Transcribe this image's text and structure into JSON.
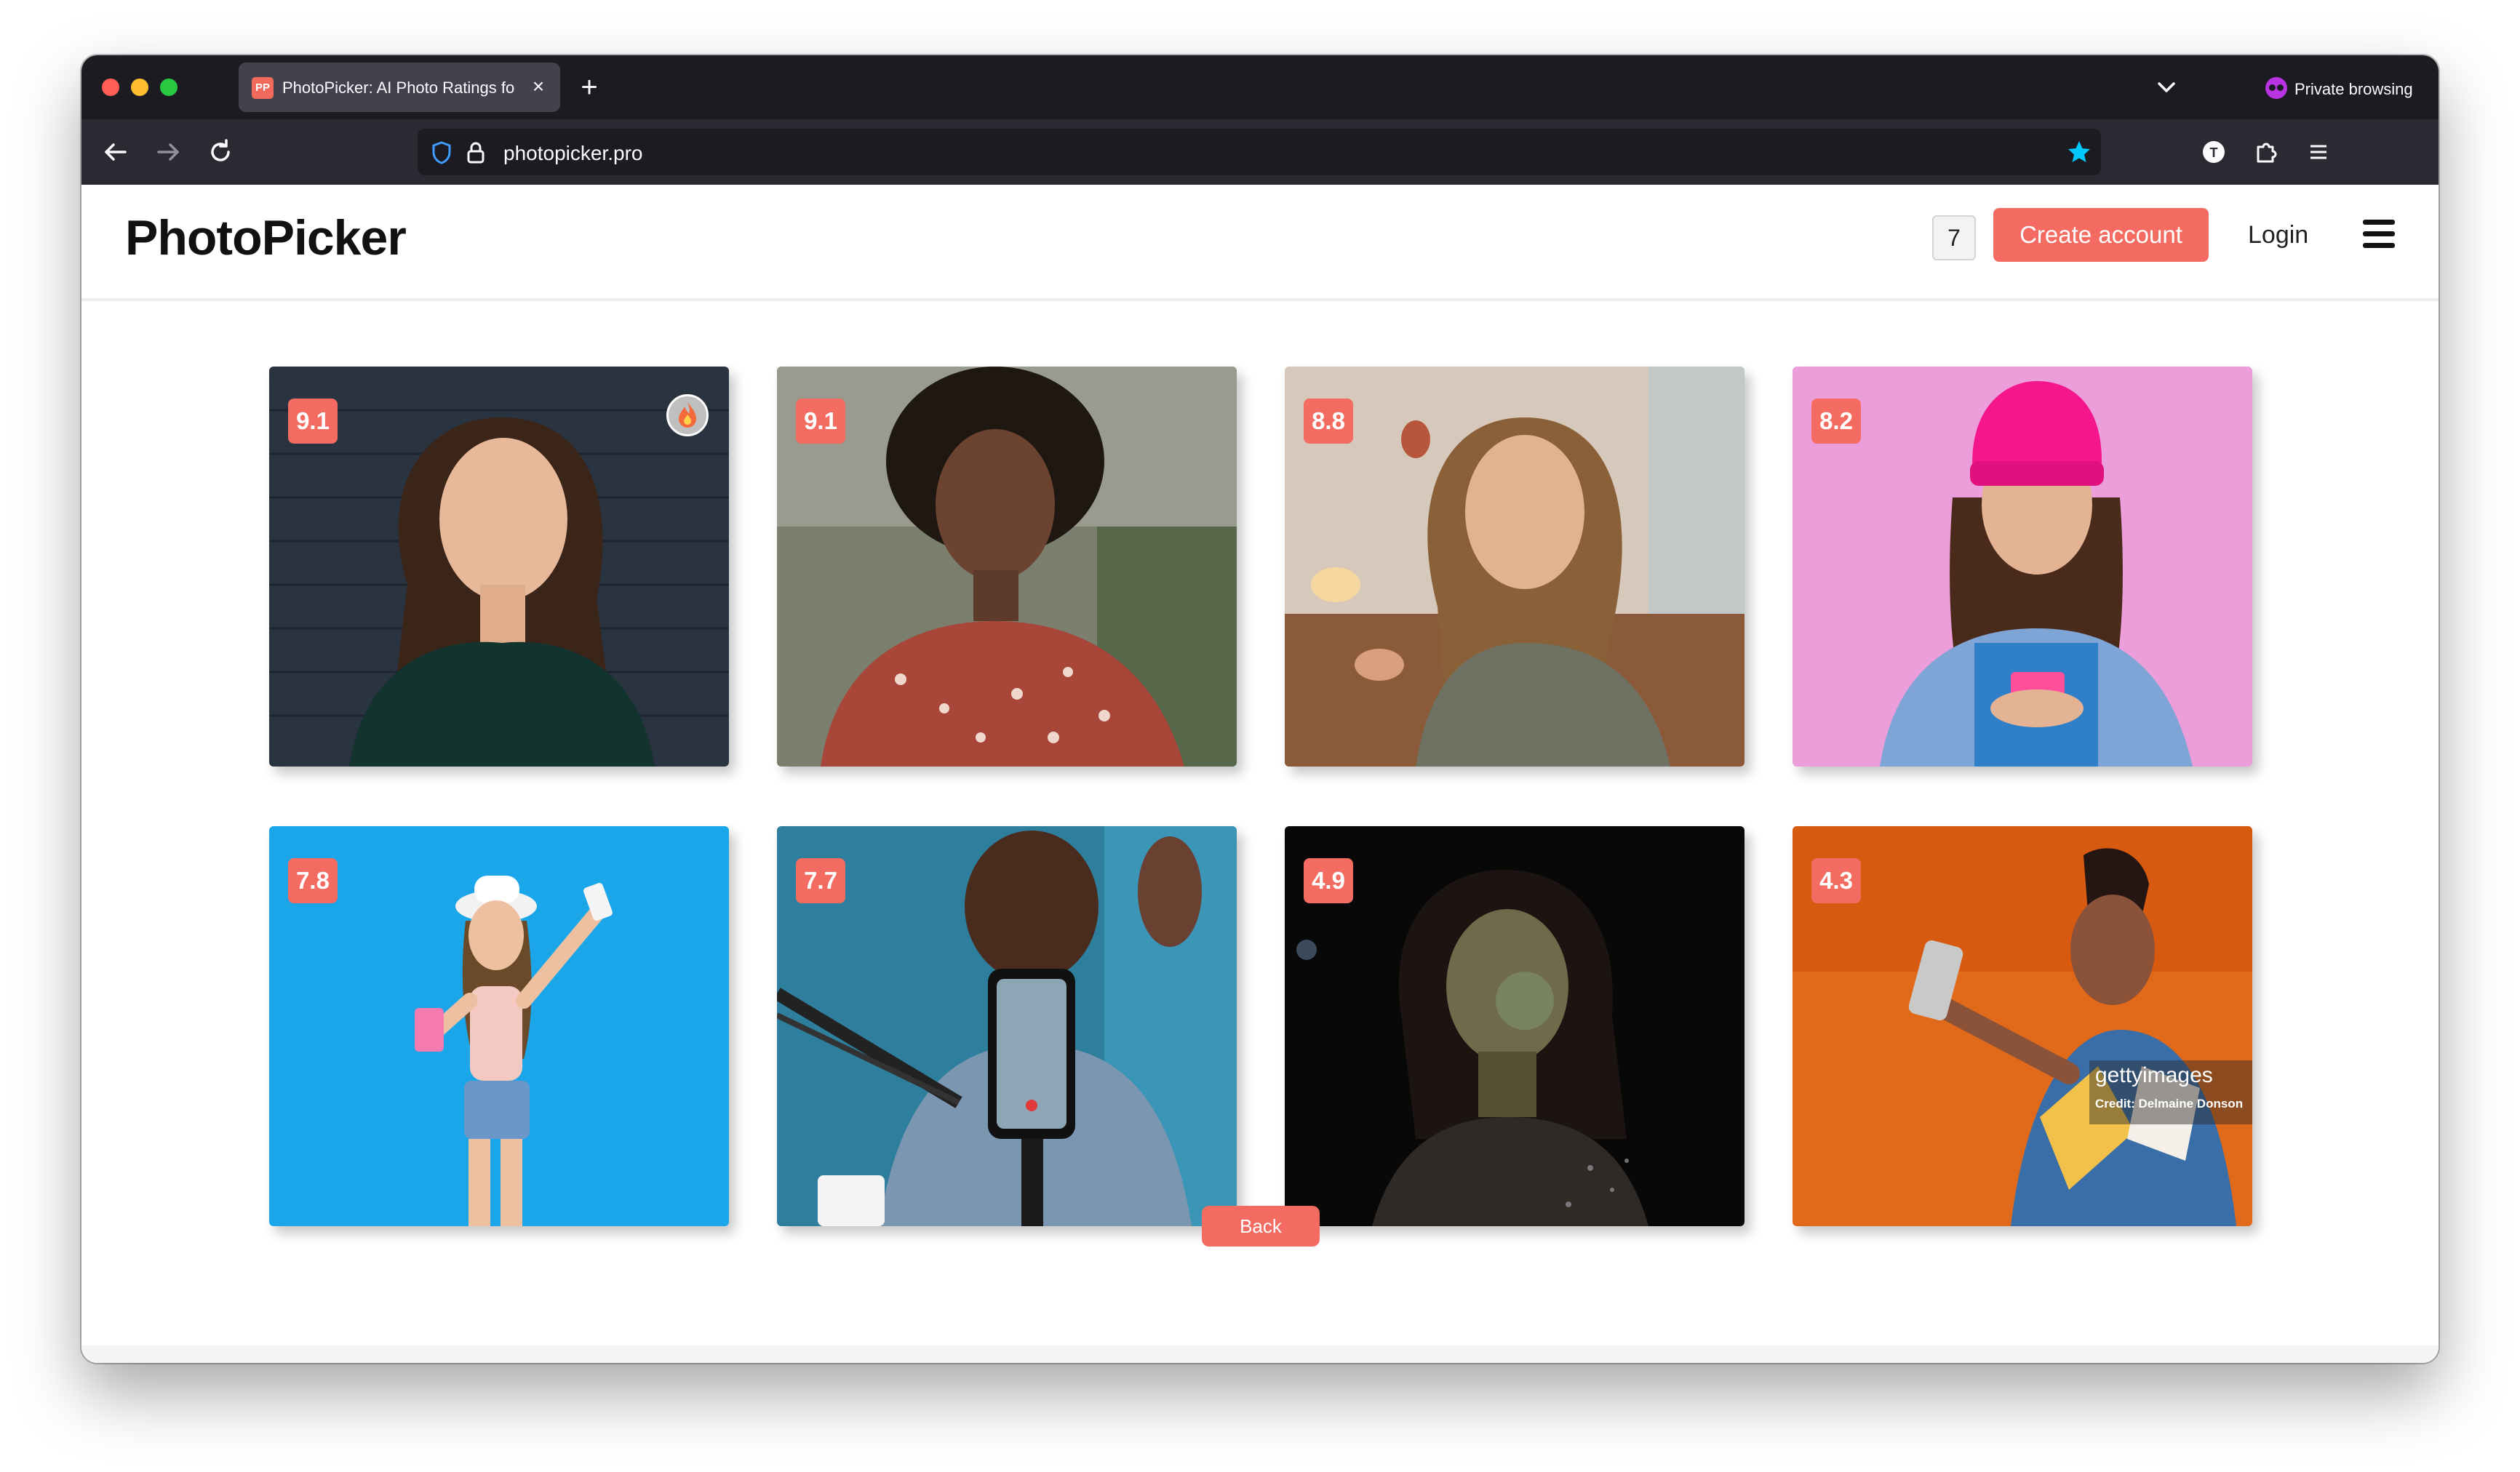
{
  "browser": {
    "tab": {
      "favicon_text": "PP",
      "title": "PhotoPicker: AI Photo Ratings for"
    },
    "private_label": "Private browsing",
    "url": "photopicker.pro"
  },
  "header": {
    "logo": "PhotoPicker",
    "count": "7",
    "create_account": "Create account",
    "login": "Login"
  },
  "photos": [
    {
      "score": "9.1",
      "top_pick": true
    },
    {
      "score": "9.1"
    },
    {
      "score": "8.8"
    },
    {
      "score": "8.2"
    },
    {
      "score": "7.8"
    },
    {
      "score": "7.7"
    },
    {
      "score": "4.9"
    },
    {
      "score": "4.3",
      "watermark": {
        "brand": "gettyimages",
        "credit": "Credit: Delmaine Donson"
      }
    }
  ],
  "back_label": "Back",
  "colors": {
    "accent": "#f36b61",
    "chrome_dark": "#1c1b22",
    "chrome_toolbar": "#2b2a33",
    "star": "#00c8ff"
  },
  "icons": [
    "back-arrow-icon",
    "forward-arrow-icon",
    "reload-icon",
    "shield-icon",
    "lock-icon",
    "star-icon",
    "account-icon",
    "extensions-icon",
    "app-menu-icon",
    "fire-icon",
    "hamburger-icon"
  ]
}
